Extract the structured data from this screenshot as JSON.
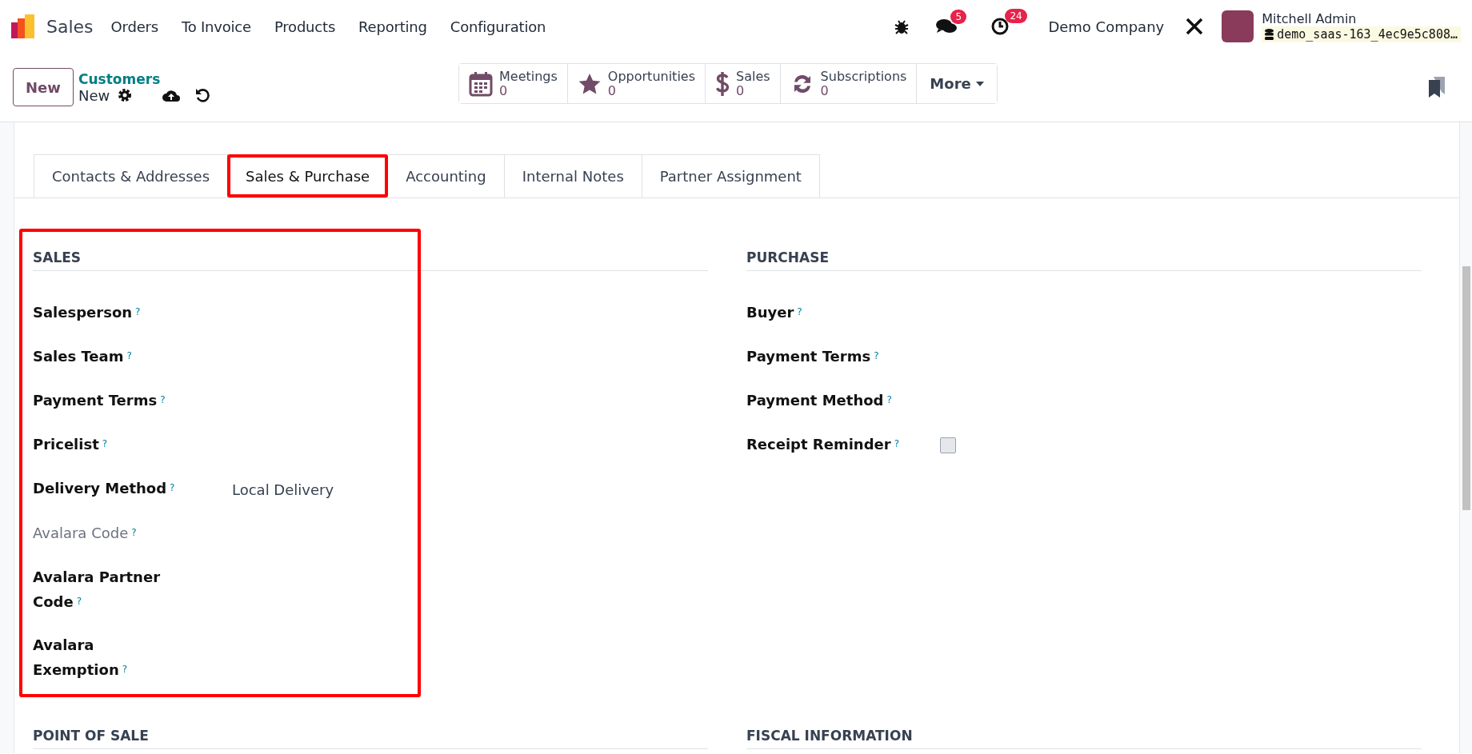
{
  "navbar": {
    "app_name": "Sales",
    "menu": [
      "Orders",
      "To Invoice",
      "Products",
      "Reporting",
      "Configuration"
    ],
    "messages_badge": "5",
    "activities_badge": "24",
    "company": "Demo Company",
    "user_name": "Mitchell Admin",
    "database": "demo_saas-163_4ec9e5c808…"
  },
  "control_panel": {
    "new_button": "New",
    "breadcrumb": "Customers",
    "record": "New",
    "smart_buttons": [
      {
        "kind": "calendar",
        "label": "Meetings",
        "count": "0"
      },
      {
        "kind": "star",
        "label": "Opportunities",
        "count": "0"
      },
      {
        "kind": "dollar",
        "label": "Sales",
        "count": "0"
      },
      {
        "kind": "refresh",
        "label": "Subscriptions",
        "count": "0"
      }
    ],
    "more_button": "More"
  },
  "tabs": [
    {
      "label": "Contacts & Addresses",
      "selected": false,
      "highlighted": false
    },
    {
      "label": "Sales & Purchase",
      "selected": true,
      "highlighted": true
    },
    {
      "label": "Accounting",
      "selected": false,
      "highlighted": false
    },
    {
      "label": "Internal Notes",
      "selected": false,
      "highlighted": false
    },
    {
      "label": "Partner Assignment",
      "selected": false,
      "highlighted": false
    }
  ],
  "groups": [
    {
      "title": "SALES",
      "highlighted": true,
      "fields": [
        {
          "kind": "text",
          "label": "Salesperson",
          "help": "?",
          "muted": false
        },
        {
          "kind": "text",
          "label": "Sales Team",
          "help": "?",
          "muted": false
        },
        {
          "kind": "text",
          "label": "Payment Terms",
          "help": "?",
          "muted": false
        },
        {
          "kind": "text",
          "label": "Pricelist",
          "help": "?",
          "muted": false
        },
        {
          "kind": "text",
          "label": "Delivery Method",
          "help": "?",
          "muted": false,
          "value": "Local Delivery"
        },
        {
          "kind": "text",
          "label": "Avalara Code",
          "help": "?",
          "muted": true
        },
        {
          "kind": "text",
          "label": "Avalara Partner Code",
          "help": "?",
          "muted": false
        },
        {
          "kind": "text",
          "label": "Avalara Exemption",
          "help": "?",
          "muted": false
        }
      ]
    },
    {
      "title": "PURCHASE",
      "highlighted": false,
      "fields": [
        {
          "kind": "text",
          "label": "Buyer",
          "help": "?",
          "muted": false
        },
        {
          "kind": "text",
          "label": "Payment Terms",
          "help": "?",
          "muted": false
        },
        {
          "kind": "text",
          "label": "Payment Method",
          "help": "?",
          "muted": false
        },
        {
          "kind": "checkbox",
          "label": "Receipt Reminder",
          "help": "?",
          "muted": false,
          "checked": false
        }
      ]
    },
    {
      "title": "POINT OF SALE",
      "highlighted": false
    },
    {
      "title": "FISCAL INFORMATION",
      "highlighted": false
    }
  ]
}
